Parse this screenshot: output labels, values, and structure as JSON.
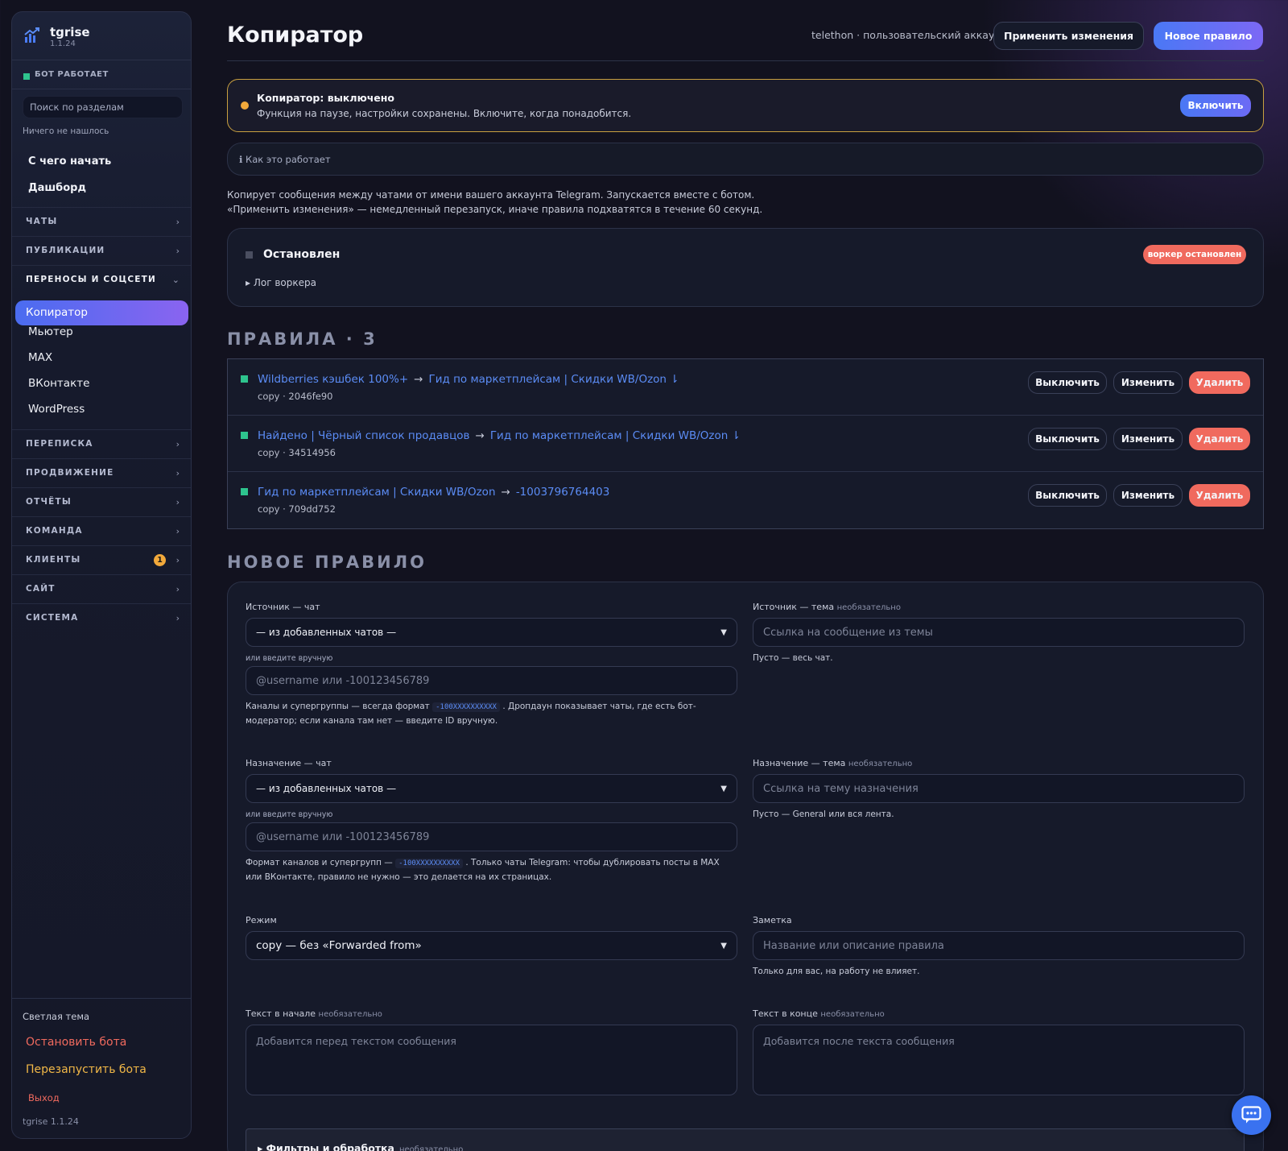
{
  "sidebar": {
    "brand_name": "tgrise",
    "brand_version": "1.1.24",
    "bot_status": "БОТ РАБОТАЕТ",
    "search_placeholder": "Поиск по разделам",
    "nothing_found": "Ничего не нашлось",
    "links": [
      "С чего начать",
      "Дашборд"
    ],
    "sections": {
      "chats": "ЧАТЫ",
      "publications": "ПУБЛИКАЦИИ",
      "transfers": "ПЕРЕНОСЫ И СОЦСЕТИ",
      "correspondence": "ПЕРЕПИСКА",
      "promotion": "ПРОДВИЖЕНИЕ",
      "reports": "ОТЧЁТЫ",
      "team": "КОМАНДА",
      "clients": "КЛИЕНТЫ",
      "site": "САЙТ",
      "system": "СИСТЕМА"
    },
    "clients_badge": "1",
    "transfers_items": [
      "Копиратор",
      "Мьютер",
      "MAX",
      "ВКонтакте",
      "WordPress"
    ],
    "footer": {
      "theme": "Светлая тема",
      "stop": "Остановить бота",
      "restart": "Перезапустить бота",
      "logout": "Выход",
      "version": "tgrise 1.1.24"
    }
  },
  "header": {
    "title": "Копиратор",
    "account": "telethon · пользовательский аккаунт",
    "apply": "Применить изменения",
    "new_rule": "Новое правило"
  },
  "alert": {
    "title": "Копиратор: выключено",
    "text": "Функция на паузе, настройки сохранены. Включите, когда понадобится.",
    "enable": "Включить"
  },
  "how": "ℹ Как это работает",
  "description": [
    "Копирует сообщения между чатами от имени вашего аккаунта Telegram. Запускается вместе с ботом.",
    "«Применить изменения» — немедленный перезапуск, иначе правила подхватятся в течение 60 секунд."
  ],
  "worker": {
    "status": "Остановлен",
    "log": "▸ Лог воркера",
    "badge": "воркер остановлен"
  },
  "rules_heading": "ПРАВИЛА · 3",
  "rules": [
    {
      "source": "Wildberries кэшбек 100%+",
      "target": "Гид по маркетплейсам | Скидки WB/Ozon ⇂",
      "meta": "copy · 2046fe90"
    },
    {
      "source": "Найдено | Чёрный список продавцов",
      "target": "Гид по маркетплейсам | Скидки WB/Ozon ⇂",
      "meta": "copy · 34514956"
    },
    {
      "source": "Гид по маркетплейсам | Скидки WB/Ozon",
      "target": "-1003796764403",
      "meta": "copy · 709dd752"
    }
  ],
  "rule_buttons": {
    "disable": "Выключить",
    "edit": "Изменить",
    "delete": "Удалить"
  },
  "arrow": "→",
  "new_rule_heading": "НОВОЕ ПРАВИЛО",
  "form": {
    "optional": "необязательно",
    "source_chat_label": "Источник — чат",
    "source_select": "— из добавленных чатов —",
    "manual_label": "или введите вручную",
    "manual_placeholder": "@username или -100123456789",
    "source_hint_a": "Каналы и супергруппы — всегда формат",
    "hex_code": "-100XXXXXXXXXX",
    "source_hint_b": ". Дропдаун показывает чаты, где есть бот-модератор; если канала там нет — введите ID вручную.",
    "source_topic_label": "Источник — тема",
    "source_topic_placeholder": "Ссылка на сообщение из темы",
    "source_topic_hint": "Пусто — весь чат.",
    "target_chat_label": "Назначение — чат",
    "target_hint_a": "Формат каналов и супергрупп —",
    "target_hint_b": ". Только чаты Telegram: чтобы дублировать посты в MAX или ВКонтакте, правило не нужно — это делается на их страницах.",
    "target_topic_label": "Назначение — тема",
    "target_topic_placeholder": "Ссылка на тему назначения",
    "target_topic_hint": "Пусто — General или вся лента.",
    "mode_label": "Режим",
    "mode_value": "copy — без «Forwarded from»",
    "note_label": "Заметка",
    "note_placeholder": "Название или описание правила",
    "note_hint": "Только для вас, на работу не влияет.",
    "prefix_label": "Текст в начале",
    "prefix_placeholder": "Добавится перед текстом сообщения",
    "suffix_label": "Текст в конце",
    "suffix_placeholder": "Добавится после текста сообщения",
    "filters": "▸ Фильтры и обработка"
  }
}
